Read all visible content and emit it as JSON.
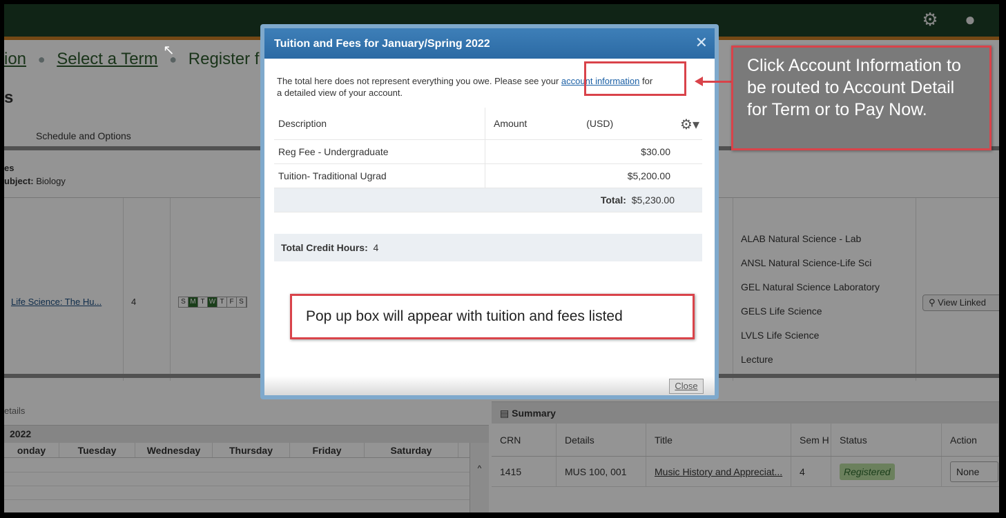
{
  "topbar": {
    "settings_icon": "gear-icon",
    "user_icon": "user-icon"
  },
  "breadcrumbs": {
    "item1": "ion",
    "item2": "Select a Term",
    "item3": "Register f"
  },
  "page_heading": "s",
  "tabs": {
    "schedule_options": "Schedule and Options"
  },
  "filters": {
    "line1": "es",
    "subject_label": "ubject:",
    "subject_value": "Biology"
  },
  "course": {
    "title": "Life Science: The Hu...",
    "hours": "4",
    "days": [
      "S",
      "M",
      "T",
      "W",
      "T",
      "F",
      "S"
    ],
    "days_active": [
      false,
      true,
      false,
      true,
      false,
      false,
      false
    ]
  },
  "attributes": [
    "ALAB Natural Science - Lab",
    "ANSL Natural Science-Life Sci",
    "GEL Natural Science Laboratory",
    "GELS Life Science",
    "LVLS Life Science",
    "Lecture"
  ],
  "view_linked_label": "View Linked",
  "schedule": {
    "title": "etails",
    "week_label": "2022",
    "days": [
      "onday",
      "Tuesday",
      "Wednesday",
      "Thursday",
      "Friday",
      "Saturday"
    ]
  },
  "summary": {
    "title": "Summary",
    "headers": [
      "CRN",
      "Details",
      "Title",
      "Sem H",
      "Status",
      "Action"
    ],
    "row": {
      "crn": "1415",
      "details": "MUS 100, 001",
      "title": "Music History and Appreciat...",
      "hours": "4",
      "status": "Registered",
      "action": "None"
    }
  },
  "modal": {
    "title": "Tuition and Fees for January/Spring 2022",
    "note_before": "The total here does not represent everything you owe. Please see your ",
    "note_link": "account information",
    "note_after": " for",
    "note_line2": "a detailed view of your account.",
    "headers": {
      "description": "Description",
      "amount": "Amount",
      "currency": "(USD)"
    },
    "fees": [
      {
        "description": "Reg Fee - Undergraduate",
        "amount": "$30.00"
      },
      {
        "description": "Tuition- Traditional Ugrad",
        "amount": "$5,200.00"
      }
    ],
    "total_label": "Total:",
    "total_value": "$5,230.00",
    "credit_label": "Total Credit Hours:",
    "credit_value": "4",
    "close_label": "Close"
  },
  "annotations": {
    "right_callout": "Click Account Information to be routed to Account Detail for Term or to Pay Now.",
    "popup_callout": "Pop up box will appear with tuition and fees listed"
  },
  "colors": {
    "topbar": "#1c3f26",
    "accent_orange": "#c97d25",
    "modal_header": "#2b6aa4",
    "callout_border": "#d9434a"
  }
}
